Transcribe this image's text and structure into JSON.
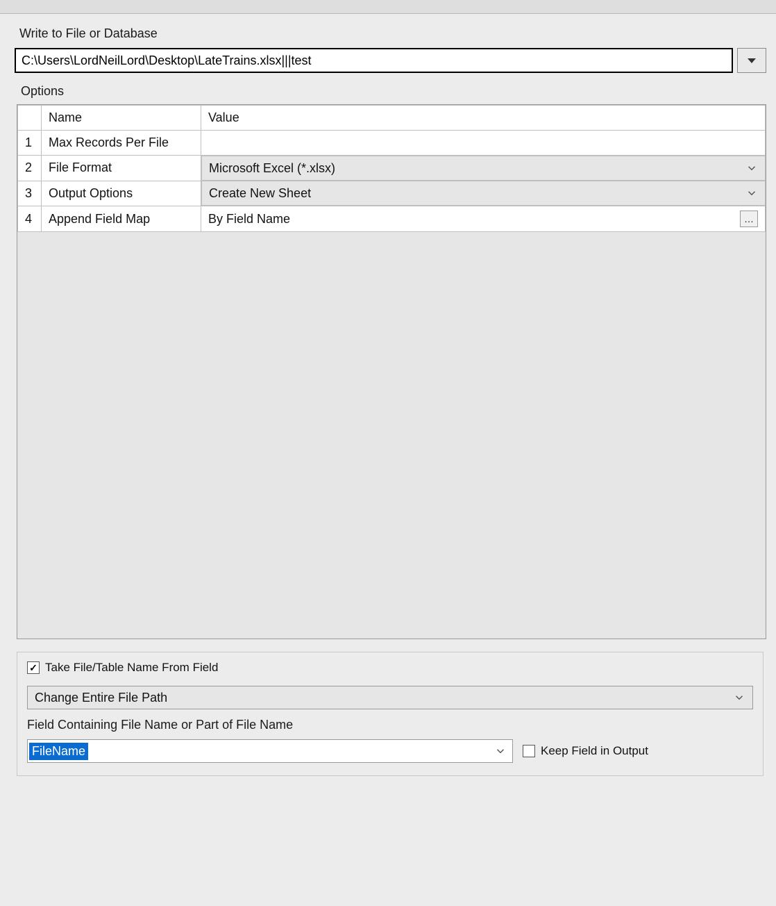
{
  "header": {
    "write_label": "Write to File or Database",
    "file_path": "C:\\Users\\LordNeilLord\\Desktop\\LateTrains.xlsx|||test"
  },
  "options": {
    "label": "Options",
    "columns": {
      "name": "Name",
      "value": "Value"
    },
    "rows": [
      {
        "num": "1",
        "name": "Max Records Per File",
        "value": "",
        "style": "white",
        "control": "text"
      },
      {
        "num": "2",
        "name": "File Format",
        "value": "Microsoft Excel (*.xlsx)",
        "style": "gray",
        "control": "dropdown"
      },
      {
        "num": "3",
        "name": "Output Options",
        "value": "Create New Sheet",
        "style": "gray",
        "control": "dropdown"
      },
      {
        "num": "4",
        "name": "Append Field Map",
        "value": "By Field Name",
        "style": "white",
        "control": "ellipsis"
      }
    ]
  },
  "fieldset": {
    "take_name_label": "Take File/Table Name From Field",
    "take_name_checked": true,
    "path_mode": "Change Entire File Path",
    "field_label": "Field Containing File Name or Part of File Name",
    "field_value": "FileName",
    "keep_label": "Keep Field in Output",
    "keep_checked": false
  }
}
